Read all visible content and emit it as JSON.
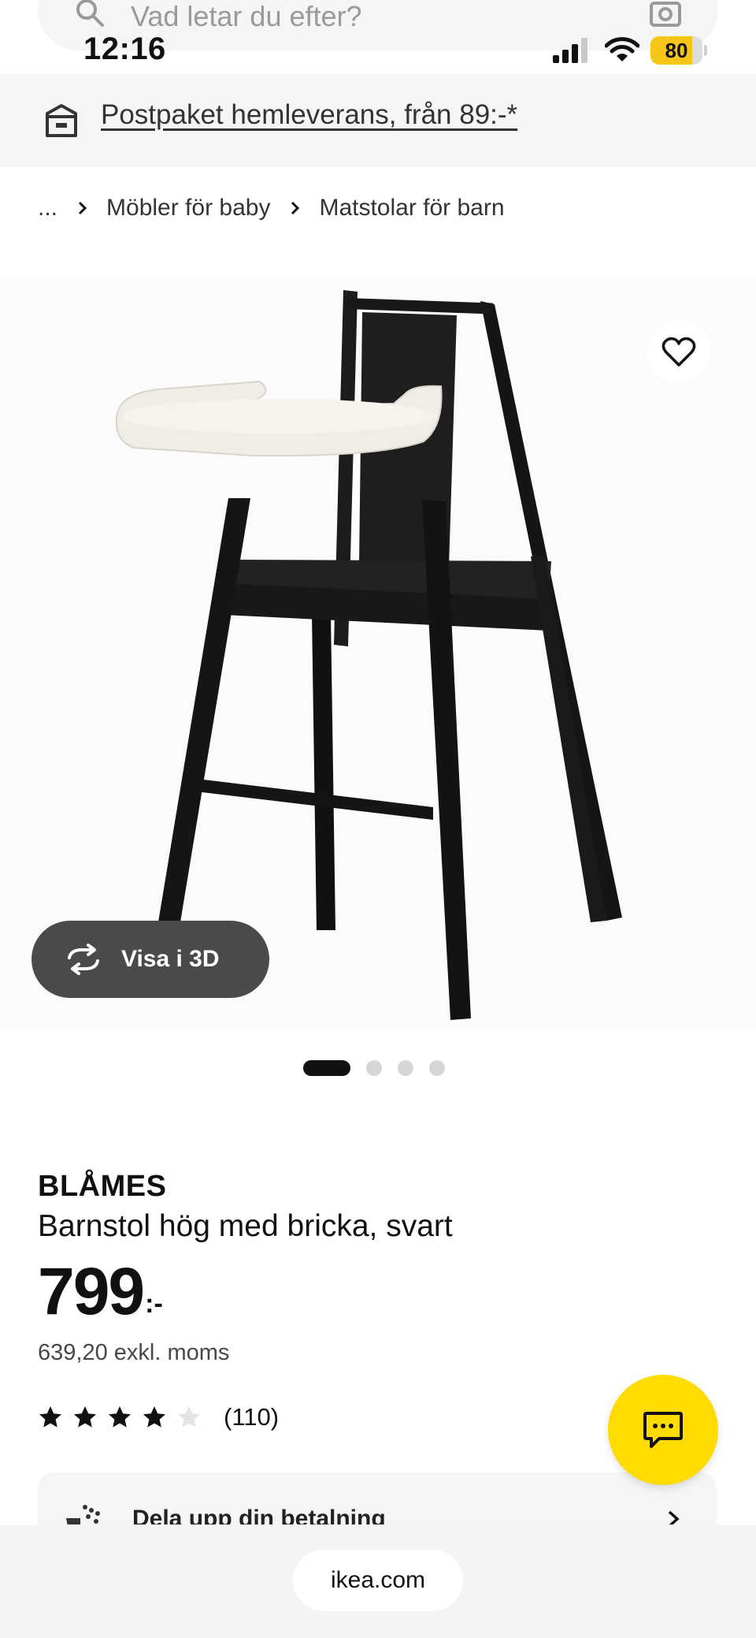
{
  "search": {
    "placeholder": "Vad letar du efter?"
  },
  "status_bar": {
    "time": "12:16",
    "battery": "80",
    "battery_level": 0.8
  },
  "banner": {
    "text": "Postpaket hemleverans, från 89:-*"
  },
  "breadcrumb": {
    "items": [
      "...",
      "Möbler för baby",
      "Matstolar för barn"
    ]
  },
  "gallery": {
    "view3d_label": "Visa i 3D",
    "image_count": 4,
    "active_index": 0
  },
  "product": {
    "brand": "BLÅMES",
    "name": "Barnstol hög med bricka, svart",
    "price": "799",
    "price_suffix": ":-",
    "vat_text": "639,20 exkl. moms",
    "rating": 4,
    "rating_max": 5,
    "review_count": "(110)"
  },
  "payment": {
    "label": "Dela upp din betalning"
  },
  "browser": {
    "url": "ikea.com"
  },
  "colors": {
    "accent_yellow": "#ffdb00",
    "battery_yellow": "#f5c518",
    "dark_button": "#4a4a4a"
  }
}
